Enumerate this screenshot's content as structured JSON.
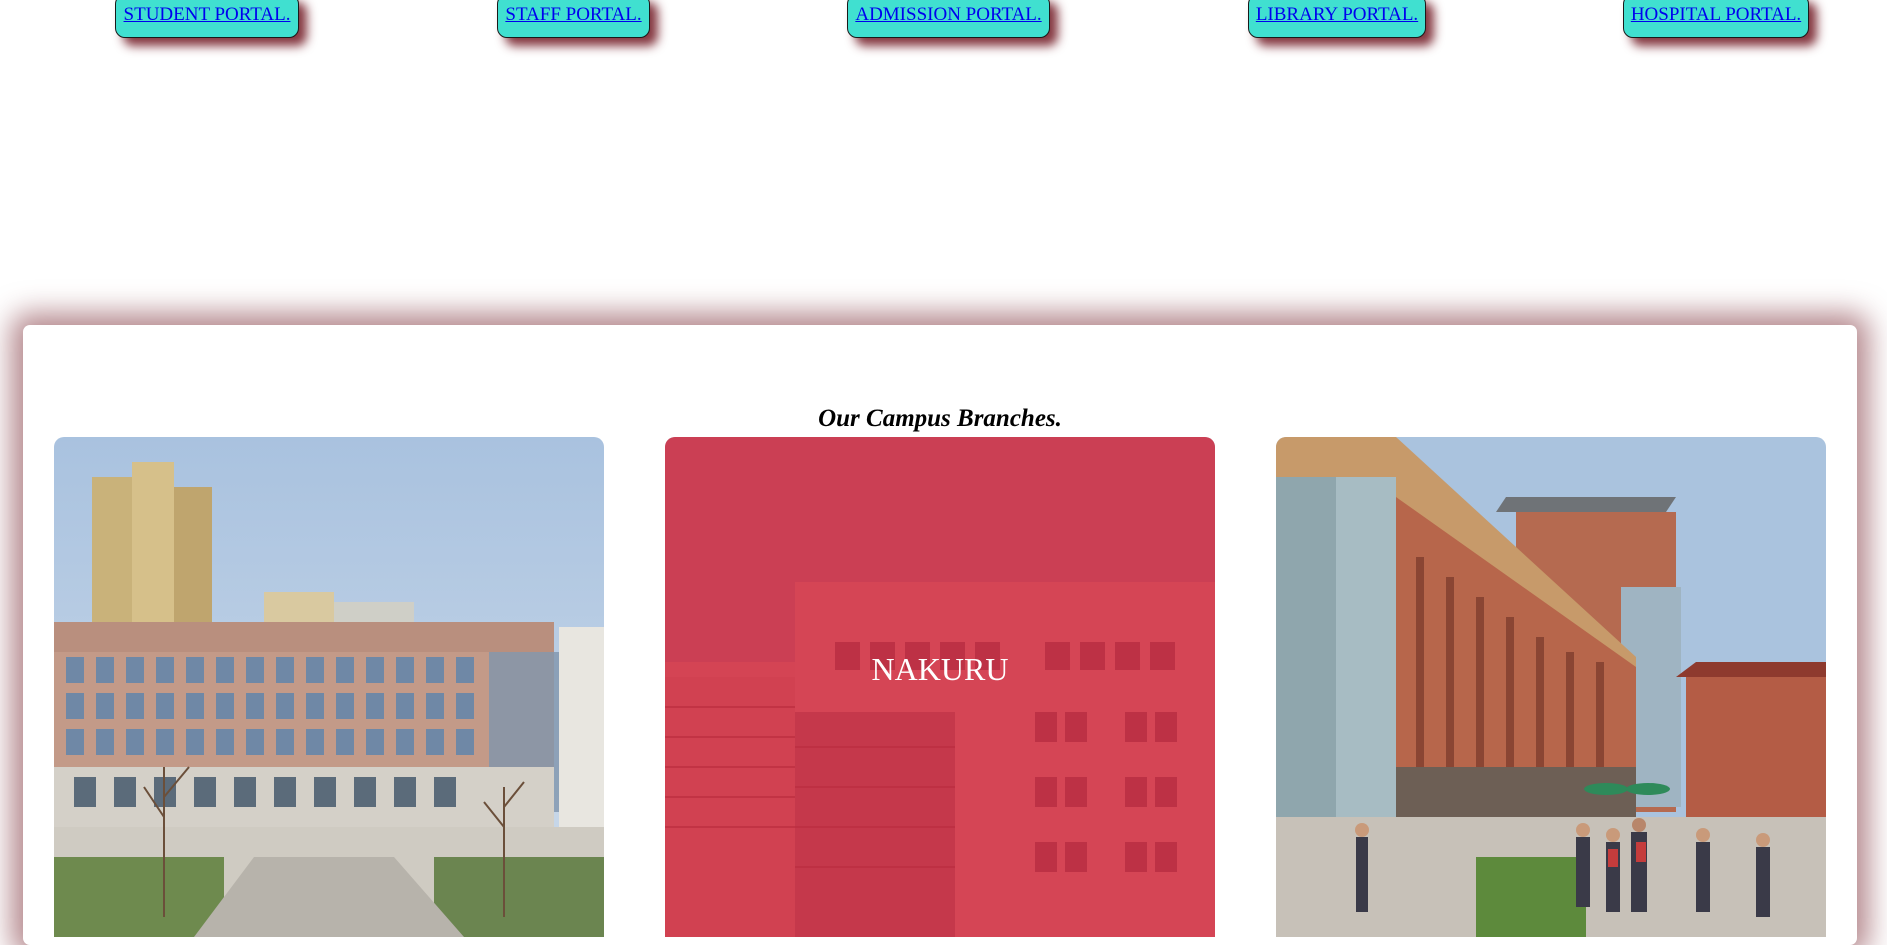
{
  "portals": [
    {
      "label": "STUDENT PORTAL."
    },
    {
      "label": "STAFF PORTAL."
    },
    {
      "label": "ADMISSION PORTAL."
    },
    {
      "label": "LIBRARY PORTAL."
    },
    {
      "label": "HOSPITAL PORTAL."
    }
  ],
  "campus": {
    "title": "Our Campus Branches.",
    "branches": [
      {
        "label": ""
      },
      {
        "label": "NAKURU"
      },
      {
        "label": ""
      }
    ]
  },
  "colors": {
    "portal_button": "#40e0d0",
    "link": "#0000ee",
    "overlay": "#dc1428",
    "shadow": "#6e141e"
  }
}
